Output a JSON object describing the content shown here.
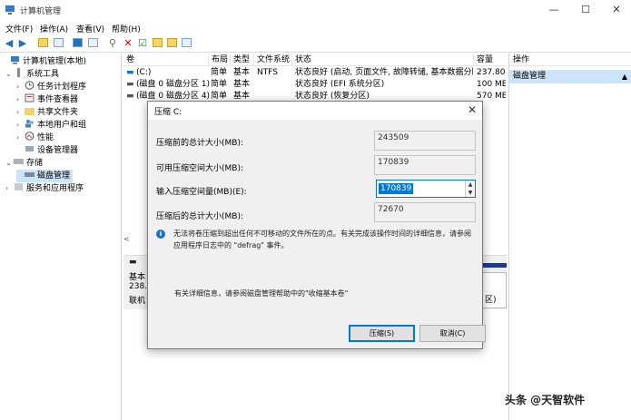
{
  "window": {
    "title": "计算机管理",
    "min_glyph": "—",
    "max_glyph": "☐",
    "close_glyph": "✕"
  },
  "menu": [
    "文件(F)",
    "操作(A)",
    "查看(V)",
    "帮助(H)"
  ],
  "tree": [
    {
      "label": "计算机管理(本地)",
      "exp": "",
      "indent": 0,
      "icon": "computer-icon"
    },
    {
      "label": "系统工具",
      "exp": "⌄",
      "indent": 1,
      "icon": "tools-icon"
    },
    {
      "label": "任务计划程序",
      "exp": "›",
      "indent": 2,
      "icon": "clock-icon"
    },
    {
      "label": "事件查看器",
      "exp": "›",
      "indent": 2,
      "icon": "event-viewer-icon"
    },
    {
      "label": "共享文件夹",
      "exp": "›",
      "indent": 2,
      "icon": "shared-folder-icon"
    },
    {
      "label": "本地用户和组",
      "exp": "›",
      "indent": 2,
      "icon": "users-icon"
    },
    {
      "label": "性能",
      "exp": "›",
      "indent": 2,
      "icon": "performance-icon"
    },
    {
      "label": "设备管理器",
      "exp": "",
      "indent": 2,
      "icon": "device-manager-icon"
    },
    {
      "label": "存储",
      "exp": "⌄",
      "indent": 1,
      "icon": "storage-icon"
    },
    {
      "label": "磁盘管理",
      "exp": "",
      "indent": 2,
      "icon": "disk-management-icon",
      "selected": true
    },
    {
      "label": "服务和应用程序",
      "exp": "›",
      "indent": 1,
      "icon": "services-icon"
    }
  ],
  "volumes": {
    "headers": [
      "卷",
      "布局",
      "类型",
      "文件系统",
      "状态",
      "容量"
    ],
    "rows": [
      [
        "(C:)",
        "简单",
        "基本",
        "NTFS",
        "状态良好 (启动, 页面文件, 故障转储, 基本数据分区)",
        "237.80"
      ],
      [
        "(磁盘 0 磁盘分区 1)",
        "简单",
        "基本",
        "",
        "状态良好 (EFI 系统分区)",
        "100 ME"
      ],
      [
        "(磁盘 0 磁盘分区 4)",
        "简单",
        "基本",
        "",
        "状态良好 (恢复分区)",
        "570 ME"
      ]
    ]
  },
  "disk": {
    "line1": "基本",
    "line2": "238.",
    "line3": "联机",
    "part_status": "区)"
  },
  "actions": {
    "header": "操作",
    "item": "磁盘管理"
  },
  "dialog": {
    "title": "压缩 C:",
    "label_total_before": "压缩前的总计大小(MB):",
    "value_total_before": "243509",
    "label_available": "可用压缩空间大小(MB):",
    "value_available": "170839",
    "label_input": "输入压缩空间量(MB)(E):",
    "value_input": "170839",
    "label_total_after": "压缩后的总计大小(MB):",
    "value_total_after": "72670",
    "info": "无法将卷压缩到超出任何不可移动的文件所在的点。有关完成该操作时间的详细信息，请参阅应用程序日志中的 \"defrag\" 事件。",
    "help": "有关详细信息，请参阅磁盘管理帮助中的\"收缩基本卷\"",
    "btn_shrink": "压缩(S)",
    "btn_cancel": "取消(C)"
  },
  "watermark": "头条 @天智软件",
  "colors": {
    "accent": "#0078d7",
    "selection": "#cce4f7",
    "disk_bar": "#1e3a8a"
  }
}
